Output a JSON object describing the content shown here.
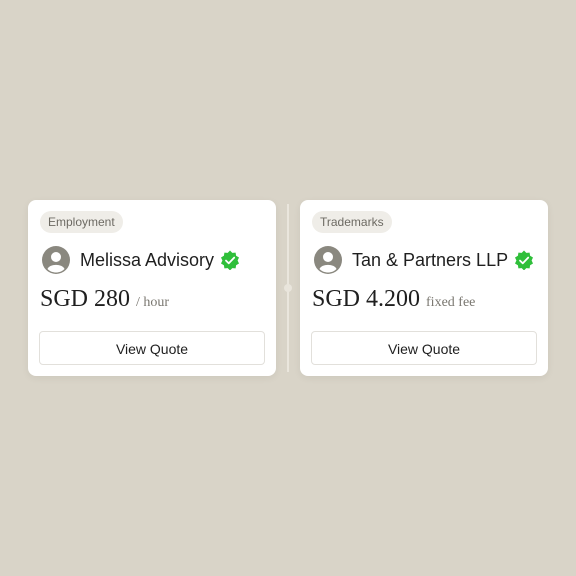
{
  "cards": [
    {
      "category": "Employment",
      "name": "Melissa Advisory",
      "price": "SGD 280",
      "unit": "/ hour",
      "button_label": "View Quote",
      "verified": true
    },
    {
      "category": "Trademarks",
      "name": "Tan & Partners LLP",
      "price": "SGD 4.200",
      "unit": "fixed fee",
      "button_label": "View Quote",
      "verified": true
    }
  ],
  "colors": {
    "background": "#d9d4c8",
    "card": "#ffffff",
    "verified_badge": "#2fbf3a",
    "avatar": "#8a887f"
  },
  "icons": {
    "avatar": "user-avatar-icon",
    "verified": "verified-badge-icon"
  }
}
